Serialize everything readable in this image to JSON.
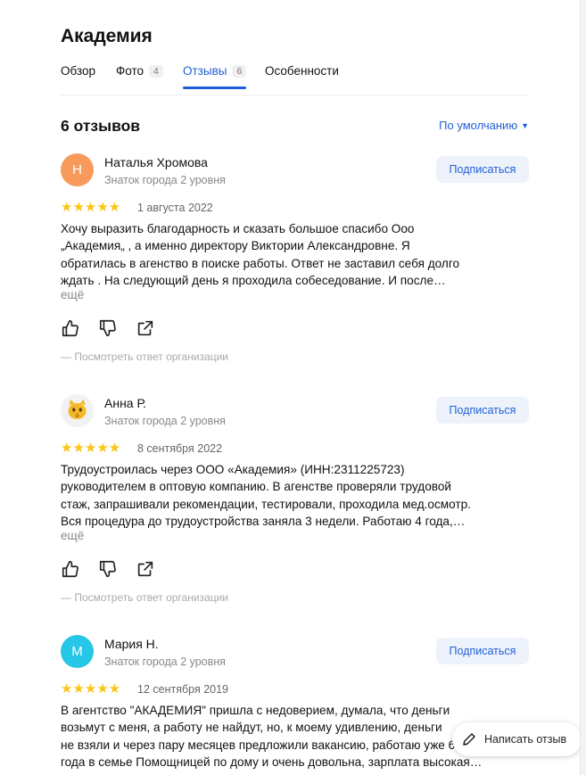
{
  "org": {
    "title": "Академия"
  },
  "tabs": [
    {
      "label": "Обзор",
      "count": ""
    },
    {
      "label": "Фото",
      "count": "4"
    },
    {
      "label": "Отзывы",
      "count": "6"
    },
    {
      "label": "Особенности",
      "count": ""
    }
  ],
  "reviews_header": {
    "title": "6 отзывов",
    "sort_label": "По умолчанию"
  },
  "reviews": [
    {
      "avatar_letter": "Н",
      "avatar_color": "#f79a5c",
      "name": "Наталья Хромова",
      "rank": "Знаток города 2 уровня",
      "subscribe": "Подписаться",
      "stars": "★★★★★",
      "date": "1 августа 2022",
      "text": "Хочу выразить благодарность и сказать большое спасибо Ооо\n„Академия„ , а именно директору Виктории Александровне. Я\nобратилась в агенство в поиске работы. Ответ не заставил себя долго\nждать . На следующий день я проходила собеседование. И после…",
      "more": "ещё",
      "org_reply": "— Посмотреть ответ организации"
    },
    {
      "avatar_letter": "",
      "avatar_color": "#f2f2f2",
      "name": "Анна Р.",
      "rank": "Знаток города 2 уровня",
      "subscribe": "Подписаться",
      "stars": "★★★★★",
      "date": "8 сентября 2022",
      "text": "Трудоустроилась через ООО «Академия» (ИНН:2311225723)\nруководителем в оптовую компанию. В агенстве проверяли трудовой\nстаж, запрашивали рекомендации, тестировали, проходила мед.осмотр.\nВся процедура до трудоустройства заняла 3 недели. Работаю 4 года,…",
      "more": "ещё",
      "org_reply": "— Посмотреть ответ организации"
    },
    {
      "avatar_letter": "М",
      "avatar_color": "#26c6e6",
      "name": "Мария Н.",
      "rank": "Знаток города 2 уровня",
      "subscribe": "Подписаться",
      "stars": "★★★★★",
      "date": "12 сентября 2019",
      "text": "В агентство \"АКАДЕМИЯ\" пришла с недоверием, думала, что деньги\nвозьмут с меня, а работу не найдут, но, к моему удивлению, деньги\nне взяли и через пару месяцев предложили вакансию, работаю уже 6\nгода в семье Помощницей по дому и очень довольна, зарплата высокая…",
      "more": "",
      "org_reply": ""
    }
  ],
  "write_review": {
    "label": "Написать отзыв"
  },
  "colors": {
    "accent": "#1f5fd6",
    "star": "#fac515"
  }
}
